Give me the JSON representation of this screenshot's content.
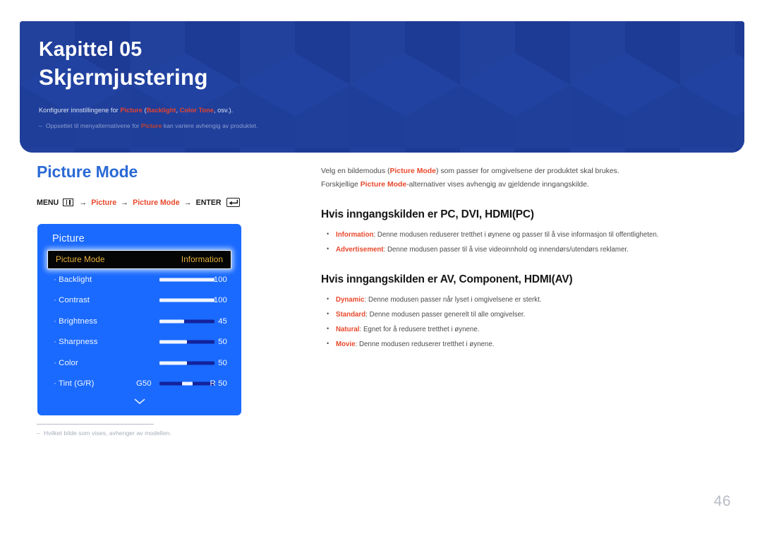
{
  "banner": {
    "chapter_number": "Kapittel 05",
    "chapter_title": "Skjermjustering",
    "subtitle_pre": "Konfigurer innstillingene for ",
    "subtitle_kw1": "Picture",
    "subtitle_mid1": " (",
    "subtitle_kw2": "Backlight",
    "subtitle_mid2": ", ",
    "subtitle_kw3": "Color Tone",
    "subtitle_post": ", osv.).",
    "note_dash": "–",
    "note_pre": "Oppsettet til menyalternativene for ",
    "note_kw": "Picture",
    "note_post": " kan variere avhengig av produktet."
  },
  "left": {
    "section_title": "Picture Mode",
    "menu_path": {
      "menu_label": "MENU",
      "menu_icon": "menu-grid-icon",
      "arrow": "→",
      "step1": "Picture",
      "step2": "Picture Mode",
      "enter_label": "ENTER",
      "enter_icon": "enter-key-icon"
    }
  },
  "osd": {
    "title": "Picture",
    "selected_row": {
      "label": "Picture Mode",
      "value": "Information"
    },
    "rows": [
      {
        "label": "· Backlight",
        "value": "100",
        "fill_pct": 100,
        "type": "bar"
      },
      {
        "label": "· Contrast",
        "value": "100",
        "fill_pct": 100,
        "type": "bar"
      },
      {
        "label": "· Brightness",
        "value": "45",
        "fill_pct": 45,
        "type": "bar"
      },
      {
        "label": "· Sharpness",
        "value": "50",
        "fill_pct": 50,
        "type": "bar"
      },
      {
        "label": "· Color",
        "value": "50",
        "fill_pct": 50,
        "type": "bar"
      },
      {
        "label": "· Tint (G/R)",
        "value": "R 50",
        "left_label": "G50",
        "fill_pct": 50,
        "type": "segment"
      }
    ],
    "scroll_down_icon": "chevron-down-icon"
  },
  "footnote": {
    "dash": "–",
    "text": "Hvilket bilde som vises, avhenger av modellen."
  },
  "right": {
    "paragraph1": {
      "pre": "Velg en bildemodus (",
      "kw": "Picture Mode",
      "post": ") som passer for omgivelsene der produktet skal brukes."
    },
    "paragraph2": {
      "pre": "Forskjellige ",
      "kw": "Picture Mode",
      "post": "-alternativer vises avhengig av gjeldende inngangskilde."
    },
    "section1": {
      "heading": "Hvis inngangskilden er PC, DVI, HDMI(PC)",
      "items": [
        {
          "term": "Information",
          "desc": ": Denne modusen reduserer tretthet i øynene og passer til å vise informasjon til offentligheten."
        },
        {
          "term": "Advertisement",
          "desc": ": Denne modusen passer til å vise videoinnhold og innendørs/utendørs reklamer."
        }
      ]
    },
    "section2": {
      "heading": "Hvis inngangskilden er AV, Component, HDMI(AV)",
      "items": [
        {
          "term": "Dynamic",
          "desc": ": Denne modusen passer når lyset i omgivelsene er sterkt."
        },
        {
          "term": "Standard",
          "desc": ": Denne modusen passer generelt til alle omgivelser."
        },
        {
          "term": "Natural",
          "desc": ": Egnet for å redusere tretthet i øynene."
        },
        {
          "term": "Movie",
          "desc": ": Denne modusen reduserer tretthet i øynene."
        }
      ]
    }
  },
  "page_number": "46",
  "colors": {
    "banner_bg": "#1f3d98",
    "accent_red": "#e8482c",
    "section_blue": "#2a6ad6",
    "osd_blue": "#1a6aff",
    "osd_highlight_text": "#e8b23c"
  }
}
